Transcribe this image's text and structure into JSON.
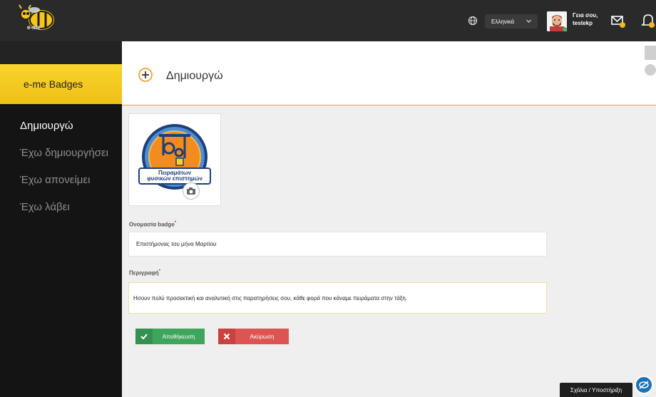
{
  "header": {
    "logo_text": "e-me",
    "language": "Ελληνικά",
    "greeting": "Γεια σου,",
    "username": "testekp"
  },
  "sidebar": {
    "title": "e-me Badges",
    "items": [
      {
        "label": "Δημιουργώ",
        "active": true
      },
      {
        "label": "Έχω δημιουργήσει",
        "active": false
      },
      {
        "label": "Έχω απονείμει",
        "active": false
      },
      {
        "label": "Έχω λάβει",
        "active": false
      }
    ]
  },
  "main": {
    "title": "Δημιουργώ",
    "badge_image_text_line1": "Πειραμάτων",
    "badge_image_text_line2": "φυσικών επιστημών",
    "name_label": "Ονομασία badge",
    "name_value": "Επιστήμονας του μήνα Μαρτίου",
    "desc_label": "Περιγραφή",
    "desc_value": "Ησουν πολύ προσεκτική και αναλυτική στις παρατηρήσεις σου, κάθε φορά που κάναμε πειράματα στην τάξη.",
    "save_label": "Αποθήκευση",
    "cancel_label": "Ακύρωση",
    "required_mark": "*"
  },
  "footer": {
    "help_label": "Σχόλια / Υποστήριξη"
  },
  "colors": {
    "accent_yellow": "#f7d42b",
    "orange_line": "#e8a237",
    "save_green": "#3fa55c",
    "cancel_red": "#dc5552"
  }
}
